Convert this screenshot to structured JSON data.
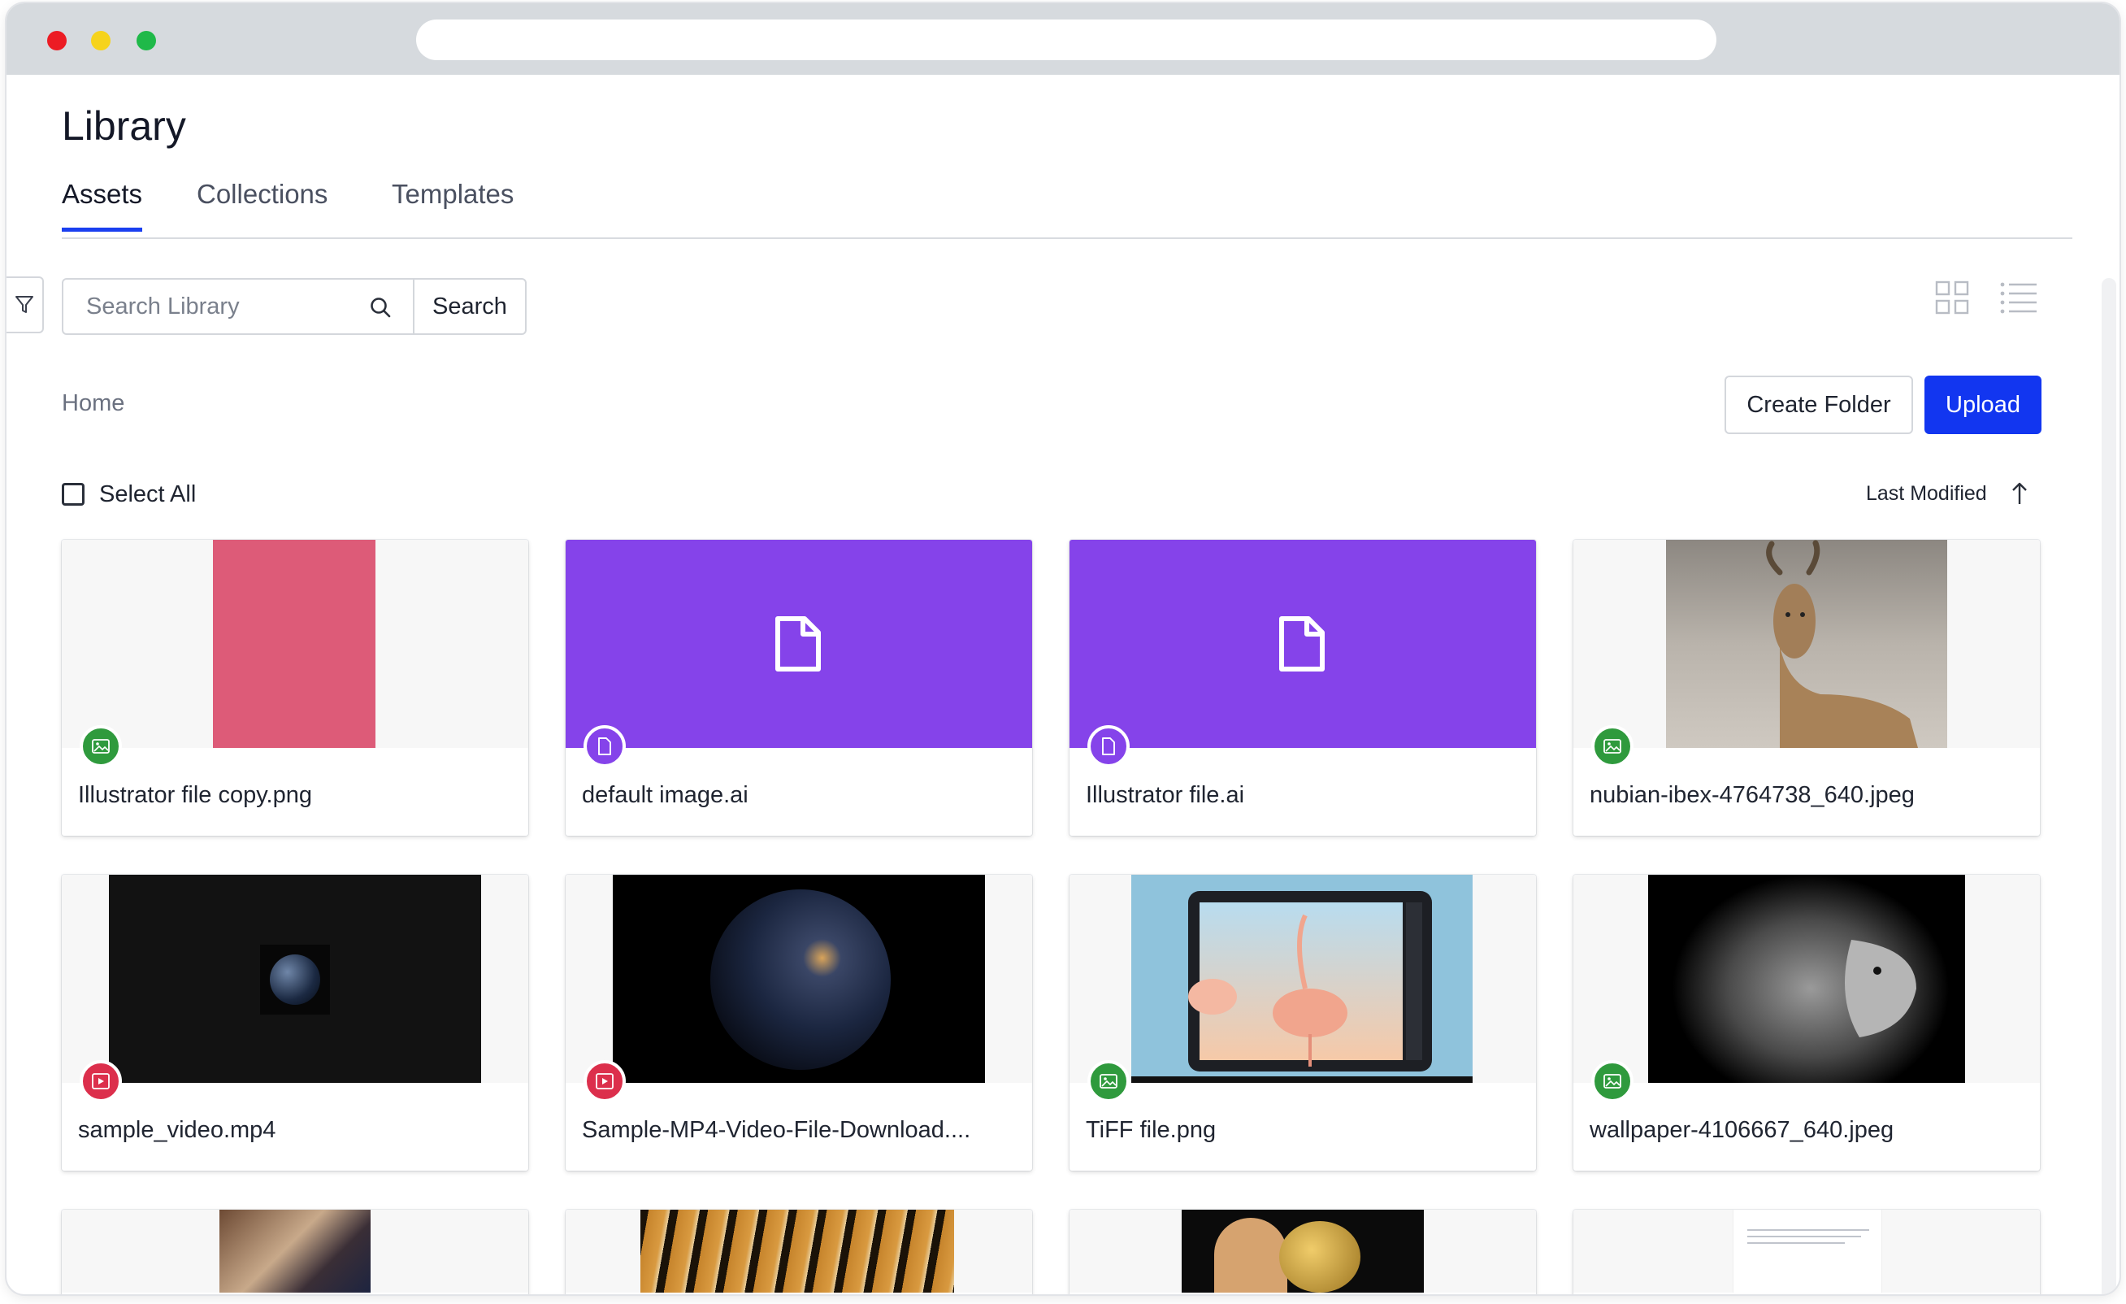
{
  "page": {
    "title": "Library"
  },
  "tabs": [
    {
      "label": "Assets",
      "active": true
    },
    {
      "label": "Collections",
      "active": false
    },
    {
      "label": "Templates",
      "active": false
    }
  ],
  "search": {
    "placeholder": "Search Library",
    "value": "",
    "button_label": "Search"
  },
  "breadcrumb": "Home",
  "actions": {
    "create_folder": "Create Folder",
    "upload": "Upload"
  },
  "select_all_label": "Select All",
  "sort": {
    "label": "Last Modified",
    "direction": "ascending"
  },
  "colors": {
    "accent": "#1236f0",
    "purple_file": "#8543ea",
    "image_badge": "#2f9a3d",
    "video_badge": "#dc2f4c"
  },
  "assets": [
    {
      "name": "Illustrator file copy.png",
      "type": "image",
      "icon": "image-icon"
    },
    {
      "name": "default image.ai",
      "type": "file",
      "icon": "file-icon"
    },
    {
      "name": "Illustrator file.ai",
      "type": "file",
      "icon": "file-icon"
    },
    {
      "name": "nubian-ibex-4764738_640.jpeg",
      "type": "image",
      "icon": "image-icon"
    },
    {
      "name": "sample_video.mp4",
      "type": "video",
      "icon": "video-icon"
    },
    {
      "name": "Sample-MP4-Video-File-Download....",
      "type": "video",
      "icon": "video-icon"
    },
    {
      "name": "TiFF file.png",
      "type": "image",
      "icon": "image-icon"
    },
    {
      "name": "wallpaper-4106667_640.jpeg",
      "type": "image",
      "icon": "image-icon"
    }
  ]
}
